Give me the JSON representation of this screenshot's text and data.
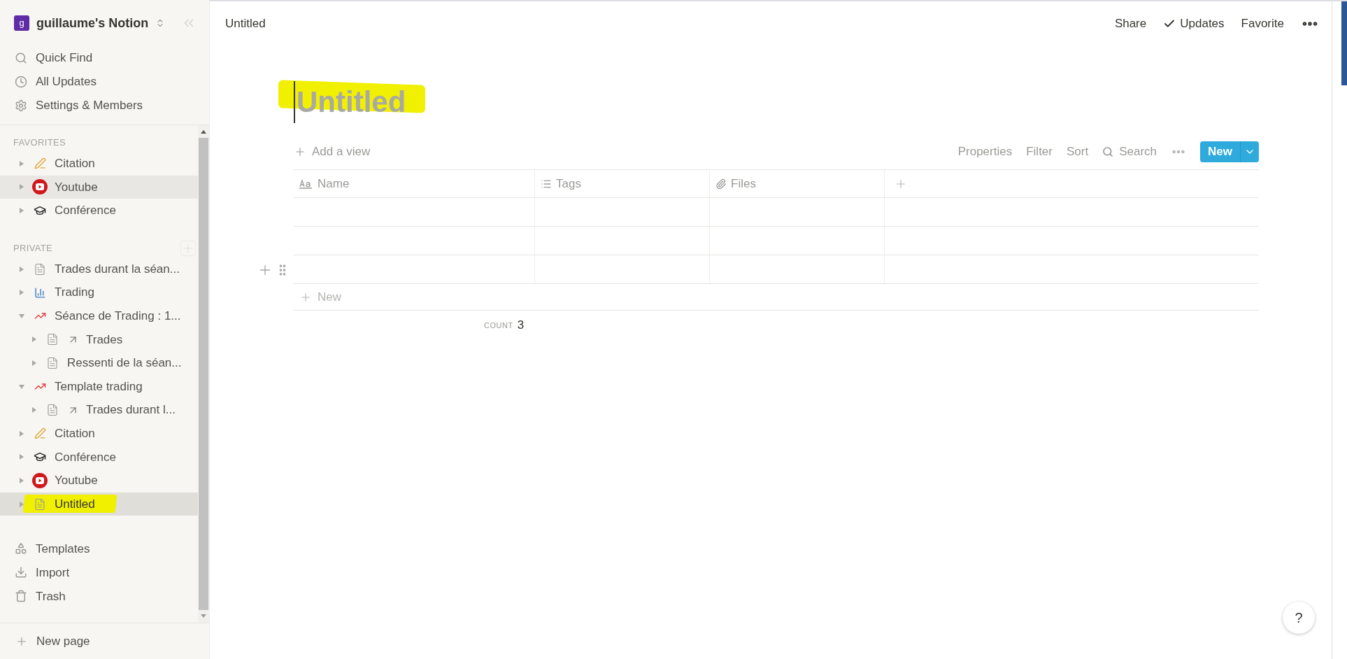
{
  "sidebar": {
    "workspace": {
      "initial": "g",
      "name": "guillaume's Notion"
    },
    "nav": [
      {
        "kind": "search",
        "label": "Quick Find"
      },
      {
        "kind": "updates",
        "label": "All Updates"
      },
      {
        "kind": "settings",
        "label": "Settings & Members"
      }
    ],
    "sections": [
      {
        "title": "FAVORITES",
        "add_button": false,
        "items": [
          {
            "kind": "writing",
            "label": "Citation",
            "expanded": false,
            "linked": false,
            "hovered": false,
            "selected": false,
            "marker": false
          },
          {
            "kind": "youtube",
            "label": "Youtube",
            "expanded": false,
            "linked": false,
            "hovered": true,
            "selected": false,
            "marker": false
          },
          {
            "kind": "cap",
            "label": "Conférence",
            "expanded": false,
            "linked": false,
            "hovered": false,
            "selected": false,
            "marker": false
          }
        ]
      },
      {
        "title": "PRIVATE",
        "add_button": true,
        "items": [
          {
            "kind": "page",
            "label": "Trades durant la séan...",
            "expanded": false,
            "linked": false,
            "hovered": false,
            "selected": false,
            "marker": false
          },
          {
            "kind": "bars",
            "label": "Trading",
            "expanded": false,
            "linked": false,
            "hovered": false,
            "selected": false,
            "marker": false
          },
          {
            "kind": "trend",
            "label": "Séance de Trading : 1...",
            "expanded": true,
            "linked": false,
            "hovered": false,
            "selected": false,
            "marker": false,
            "children": [
              {
                "kind": "page",
                "label": "Trades",
                "expanded": false,
                "linked": true,
                "hovered": false,
                "selected": false,
                "marker": false
              },
              {
                "kind": "page",
                "label": "Ressenti de la séan...",
                "expanded": false,
                "linked": false,
                "hovered": false,
                "selected": false,
                "marker": false
              }
            ]
          },
          {
            "kind": "trend",
            "label": "Template trading",
            "expanded": true,
            "linked": false,
            "hovered": false,
            "selected": false,
            "marker": false,
            "children": [
              {
                "kind": "page",
                "label": "Trades durant l...",
                "expanded": false,
                "linked": true,
                "hovered": false,
                "selected": false,
                "marker": false
              }
            ]
          },
          {
            "kind": "writing",
            "label": "Citation",
            "expanded": false,
            "linked": false,
            "hovered": false,
            "selected": false,
            "marker": false
          },
          {
            "kind": "cap",
            "label": "Conférence",
            "expanded": false,
            "linked": false,
            "hovered": false,
            "selected": false,
            "marker": false
          },
          {
            "kind": "youtube",
            "label": "Youtube",
            "expanded": false,
            "linked": false,
            "hovered": false,
            "selected": false,
            "marker": false
          },
          {
            "kind": "page",
            "label": "Untitled",
            "expanded": false,
            "linked": false,
            "hovered": false,
            "selected": true,
            "marker": true
          }
        ]
      }
    ],
    "tools": [
      {
        "kind": "templates",
        "label": "Templates"
      },
      {
        "kind": "import",
        "label": "Import"
      },
      {
        "kind": "trash",
        "label": "Trash"
      }
    ],
    "new_page": "New page"
  },
  "topbar": {
    "breadcrumb": "Untitled",
    "actions": [
      {
        "kind": "text",
        "label": "Share"
      },
      {
        "kind": "check",
        "label": "Updates"
      },
      {
        "kind": "text",
        "label": "Favorite"
      },
      {
        "kind": "more"
      }
    ]
  },
  "page": {
    "title_placeholder": "Untitled",
    "marker": true,
    "toolbar": {
      "add_view": "Add a view",
      "actions": [
        {
          "kind": "text",
          "label": "Properties"
        },
        {
          "kind": "text",
          "label": "Filter"
        },
        {
          "kind": "text",
          "label": "Sort"
        },
        {
          "kind": "search",
          "label": "Search"
        },
        {
          "kind": "more"
        }
      ],
      "new_button": "New"
    },
    "table": {
      "columns": [
        {
          "kind": "title",
          "name": "Name"
        },
        {
          "kind": "multi_select",
          "name": "Tags"
        },
        {
          "kind": "files",
          "name": "Files"
        }
      ],
      "rows": [
        {
          "hovered": false
        },
        {
          "hovered": false
        },
        {
          "hovered": true
        }
      ],
      "new_row": "New",
      "count_label": "COUNT",
      "count": "3"
    }
  },
  "help": "?"
}
